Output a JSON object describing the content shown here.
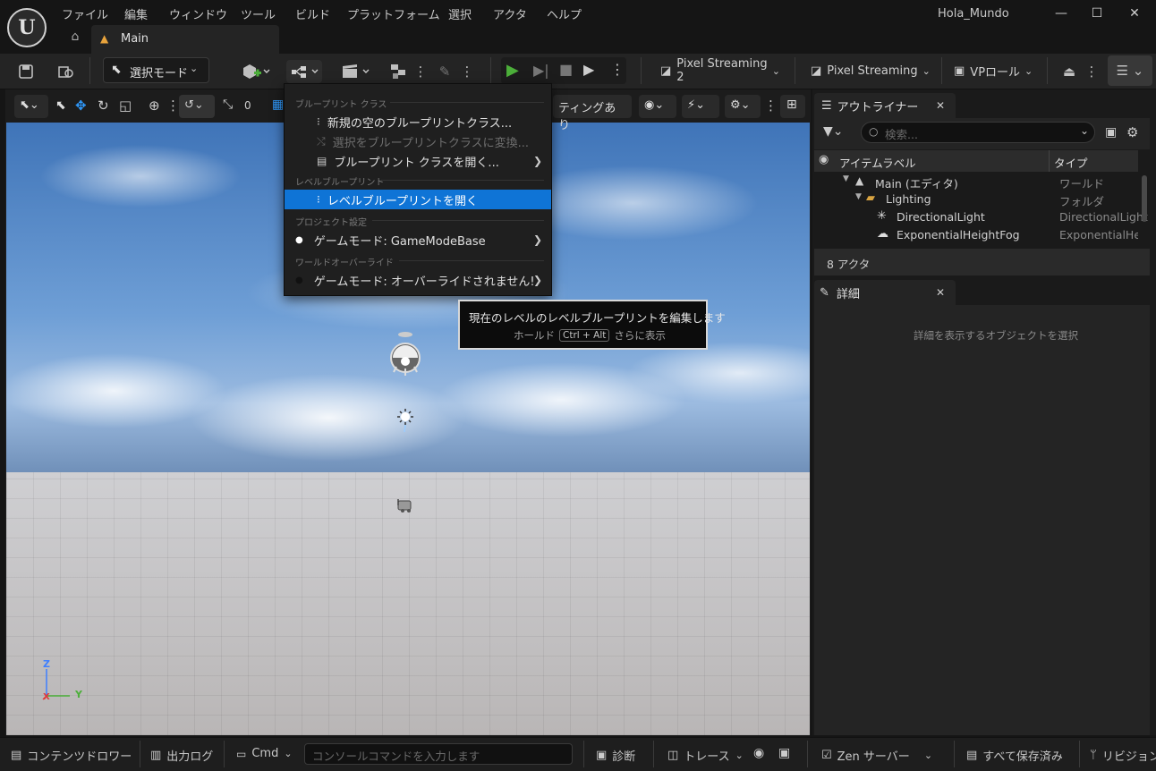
{
  "window": {
    "title": "Hola_Mundo",
    "minimize": "—",
    "maximize": "☐",
    "close": "✕"
  },
  "menubar": [
    "ファイル",
    "編集",
    "ウィンドウ",
    "ツール",
    "ビルド",
    "プラットフォーム",
    "選択",
    "アクタ",
    "ヘルプ"
  ],
  "tabs": {
    "home_icon": "⌂",
    "main": "Main"
  },
  "toolbar": {
    "mode": "選択モード",
    "pixel_streaming_2": "Pixel Streaming 2",
    "pixel_streaming": "Pixel Streaming",
    "vp_role": "VPロール"
  },
  "viewport_toolbar": {
    "lighting_partial": "ティングあり",
    "scale_value": "0"
  },
  "blueprint_menu": {
    "section_blueprint_class": "ブループリント クラス",
    "new_empty_class": "新規の空のブループリントクラス...",
    "convert_selection": "選択をブループリントクラスに変換...",
    "open_class": "ブループリント クラスを開く...",
    "section_level_blueprint": "レベルブループリント",
    "open_level_blueprint": "レベルブループリントを開く",
    "section_project_settings": "プロジェクト設定",
    "game_mode_project": "ゲームモード: GameModeBase",
    "section_world_override": "ワールドオーバーライド",
    "game_mode_override": "ゲームモード: オーバーライドされません!"
  },
  "tooltip": {
    "title": "現在のレベルのレベルブループリントを編集します",
    "hold": "ホールド",
    "shortcut": "Ctrl + Alt",
    "more": "さらに表示"
  },
  "outliner": {
    "tab": "アウトライナー",
    "search_placeholder": "検索...",
    "col_label": "アイテムラベル",
    "col_type": "タイプ",
    "rows": [
      {
        "label": "Main (エディタ)",
        "type": "ワールド"
      },
      {
        "label": "Lighting",
        "type": "フォルダ"
      },
      {
        "label": "DirectionalLight",
        "type": "DirectionalLight"
      },
      {
        "label": "ExponentialHeightFog",
        "type": "ExponentialHeig"
      }
    ],
    "actor_count": "8 アクタ"
  },
  "details": {
    "tab": "詳細",
    "empty_message": "詳細を表示するオブジェクトを選択"
  },
  "axis": {
    "z": "Z",
    "y": "Y",
    "x": "X"
  },
  "statusbar": {
    "content_drawer": "コンテンツドロワー",
    "output_log": "出力ログ",
    "cmd": "Cmd",
    "console_placeholder": "コンソールコマンドを入力します",
    "diagnostics": "診断",
    "trace": "トレース",
    "zen_server": "Zen サーバー",
    "save_all": "すべて保存済み",
    "revision": "リビジョン"
  },
  "colors": {
    "accent_blue": "#0f74d6",
    "play_green": "#4caf3a",
    "tab_orange": "#e8a33c"
  }
}
